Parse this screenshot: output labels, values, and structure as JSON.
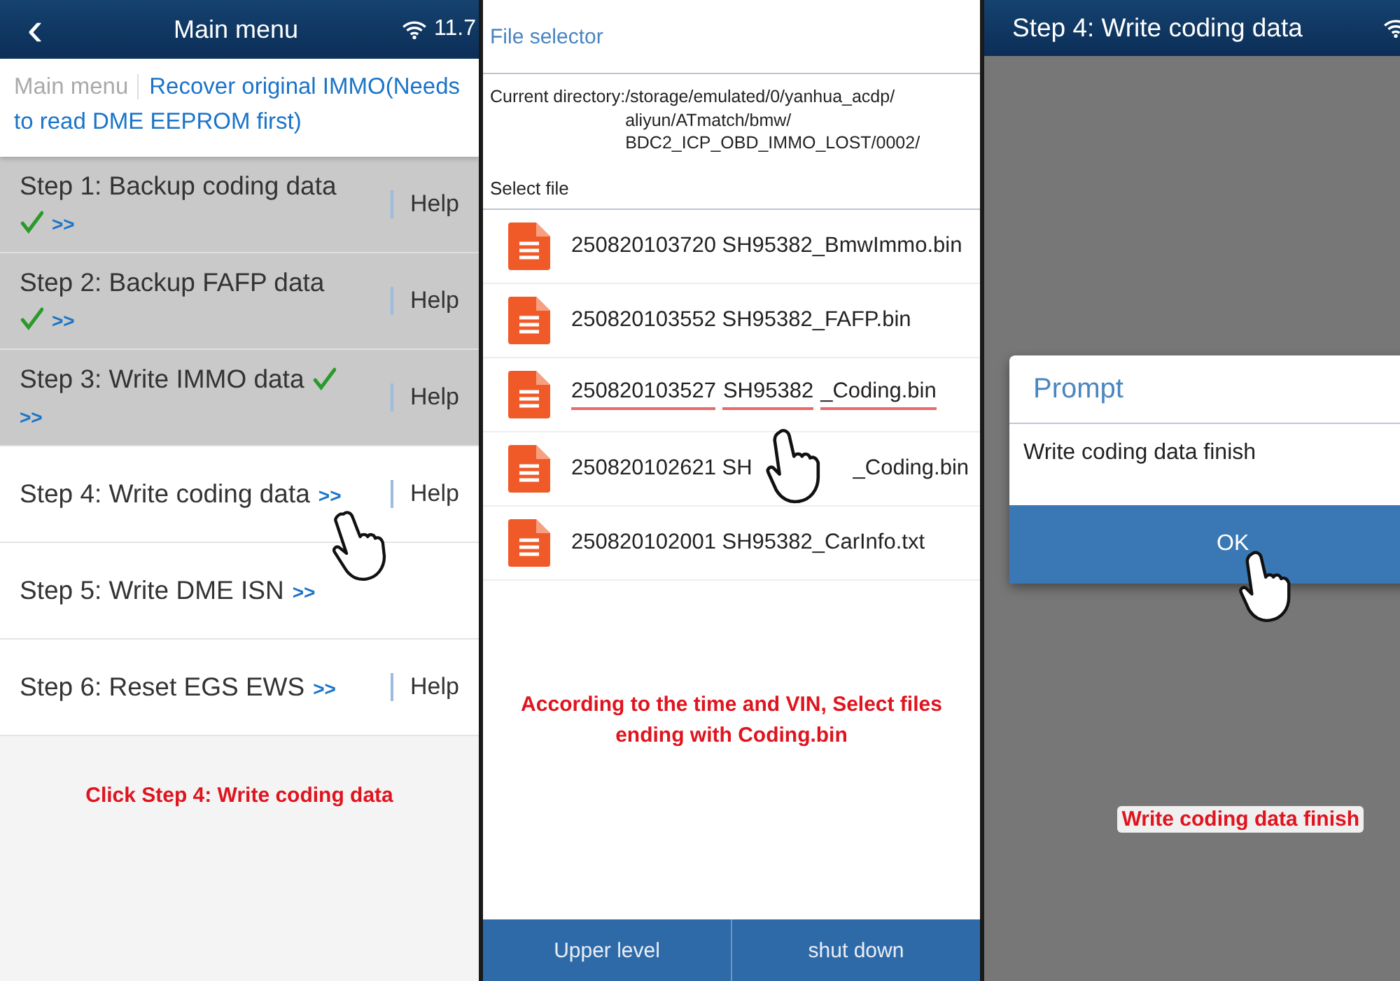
{
  "panels": [
    {
      "kind": "menu",
      "header": {
        "title": "Main menu",
        "back": "‹",
        "status": "11.7"
      },
      "breadcrumb": {
        "root": "Main menu",
        "current": "Recover original IMMO(Needs to read DME EEPROM first)"
      },
      "steps": [
        {
          "label": "Step 1: Backup coding data",
          "done": true,
          "link": ">>",
          "help": "Help",
          "pointer": false
        },
        {
          "label": "Step 2: Backup FAFP data",
          "done": true,
          "link": ">>",
          "help": "Help",
          "pointer": false
        },
        {
          "label": "Step 3: Write IMMO data",
          "done": true,
          "link": ">>",
          "help": "Help",
          "pointer": false
        },
        {
          "label": "Step 4: Write coding data",
          "done": false,
          "link": ">>",
          "help": "Help",
          "pointer": true
        },
        {
          "label": "Step 5: Write DME ISN",
          "done": false,
          "link": ">>",
          "pointer": false
        },
        {
          "label": "Step 6: Reset EGS EWS",
          "done": false,
          "link": ">>",
          "help": "Help",
          "pointer": false
        }
      ],
      "note": "Click Step 4: Write coding data"
    },
    {
      "kind": "files",
      "header": {
        "title": "File selector"
      },
      "directory_label": "Current directory:",
      "directory": [
        "/storage/emulated/0/yanhua_acdp/",
        "aliyun/ATmatch/bmw/",
        "BDC2_ICP_OBD_IMMO_LOST/0002/"
      ],
      "select_label": "Select file",
      "files": [
        {
          "parts": [
            "250820103720 SH95382_BmwImmo.bin"
          ],
          "underlined": false,
          "pointer": false
        },
        {
          "parts": [
            "250820103552 SH95382_FAFP.bin"
          ],
          "underlined": false,
          "pointer": false
        },
        {
          "parts": [
            "250820103527",
            "SH95382",
            "_Coding.bin"
          ],
          "underlined": true,
          "pointer": false
        },
        {
          "parts": [
            "250820102621 SH",
            "_Coding.bin"
          ],
          "underlined": false,
          "pointer": true
        },
        {
          "parts": [
            "250820102001 SH95382_CarInfo.txt"
          ],
          "underlined": false,
          "pointer": false
        }
      ],
      "note": "According to the time and VIN, Select files ending with Coding.bin",
      "buttons": [
        "Upper level",
        "shut down"
      ]
    },
    {
      "kind": "dialog",
      "header": {
        "title": "Step 4: Write coding data"
      },
      "dialog": {
        "title": "Prompt",
        "message": "Write coding data finish",
        "button": "OK",
        "pointer": true
      },
      "note": "Write coding data finish"
    }
  ]
}
